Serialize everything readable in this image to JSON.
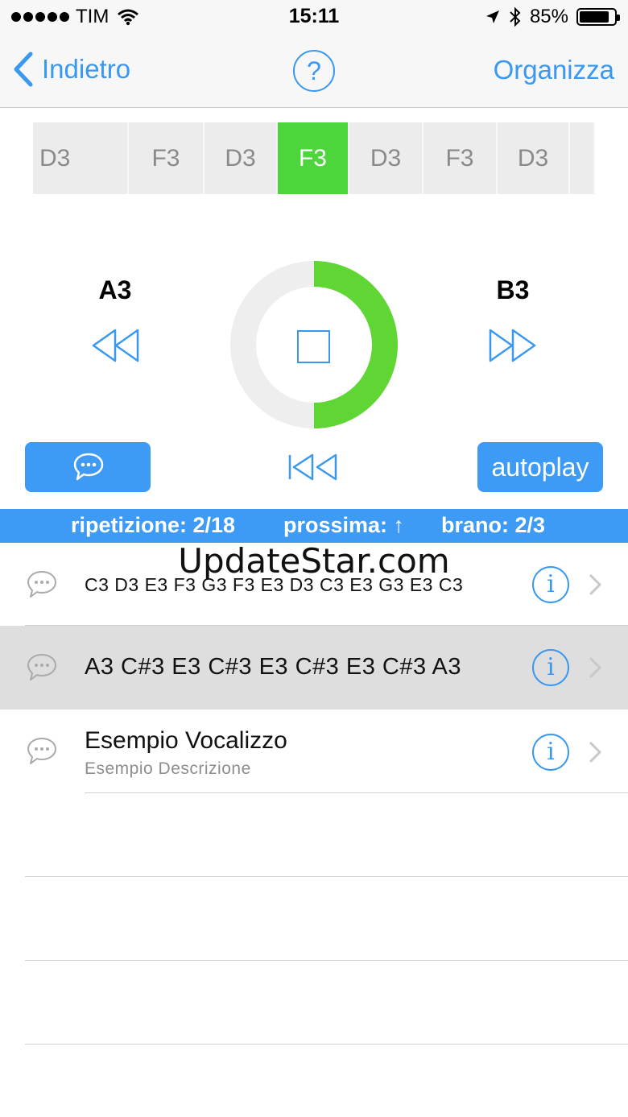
{
  "status_bar": {
    "carrier": "TIM",
    "time": "15:11",
    "battery": "85%",
    "battery_level": 0.85
  },
  "nav": {
    "back_label": "Indietro",
    "help_label": "?",
    "right_label": "Organizza"
  },
  "note_strip": {
    "cells": [
      "D3",
      "F3",
      "D3",
      "F3",
      "D3",
      "F3",
      "D3",
      ""
    ],
    "active_index": 3,
    "active_color": "#4cd63c"
  },
  "player": {
    "prev_note": "A3",
    "next_note": "B3",
    "progress": 0.5,
    "progress_color": "#5fd634",
    "autoplay_label": "autoplay"
  },
  "info_bar": {
    "repetition": "ripetizione: 2/18",
    "next": "prossima: ↑",
    "track": "brano: 2/3"
  },
  "list": {
    "items": [
      {
        "title": "C3 D3 E3 F3 G3 F3 E3 D3 C3 E3 G3 E3 C3",
        "subtitle": "",
        "selected": false
      },
      {
        "title": "A3 C#3 E3 C#3 E3 C#3 E3 C#3 A3",
        "subtitle": "",
        "selected": true
      },
      {
        "title": "Esempio Vocalizzo",
        "subtitle": "Esempio Descrizione",
        "selected": false
      }
    ]
  },
  "watermark": "UpdateStar.com",
  "colors": {
    "accent": "#3a98f0",
    "button_bg": "#3d9bf5",
    "active_green": "#4cd63c"
  }
}
